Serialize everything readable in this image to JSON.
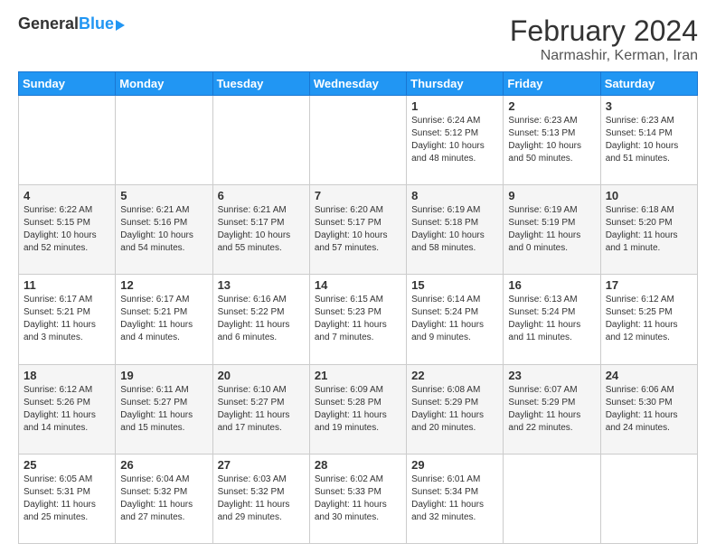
{
  "header": {
    "logo_general": "General",
    "logo_blue": "Blue",
    "title": "February 2024",
    "subtitle": "Narmashir, Kerman, Iran"
  },
  "days_of_week": [
    "Sunday",
    "Monday",
    "Tuesday",
    "Wednesday",
    "Thursday",
    "Friday",
    "Saturday"
  ],
  "weeks": [
    [
      {
        "day": "",
        "info": ""
      },
      {
        "day": "",
        "info": ""
      },
      {
        "day": "",
        "info": ""
      },
      {
        "day": "",
        "info": ""
      },
      {
        "day": "1",
        "info": "Sunrise: 6:24 AM\nSunset: 5:12 PM\nDaylight: 10 hours and 48 minutes."
      },
      {
        "day": "2",
        "info": "Sunrise: 6:23 AM\nSunset: 5:13 PM\nDaylight: 10 hours and 50 minutes."
      },
      {
        "day": "3",
        "info": "Sunrise: 6:23 AM\nSunset: 5:14 PM\nDaylight: 10 hours and 51 minutes."
      }
    ],
    [
      {
        "day": "4",
        "info": "Sunrise: 6:22 AM\nSunset: 5:15 PM\nDaylight: 10 hours and 52 minutes."
      },
      {
        "day": "5",
        "info": "Sunrise: 6:21 AM\nSunset: 5:16 PM\nDaylight: 10 hours and 54 minutes."
      },
      {
        "day": "6",
        "info": "Sunrise: 6:21 AM\nSunset: 5:17 PM\nDaylight: 10 hours and 55 minutes."
      },
      {
        "day": "7",
        "info": "Sunrise: 6:20 AM\nSunset: 5:17 PM\nDaylight: 10 hours and 57 minutes."
      },
      {
        "day": "8",
        "info": "Sunrise: 6:19 AM\nSunset: 5:18 PM\nDaylight: 10 hours and 58 minutes."
      },
      {
        "day": "9",
        "info": "Sunrise: 6:19 AM\nSunset: 5:19 PM\nDaylight: 11 hours and 0 minutes."
      },
      {
        "day": "10",
        "info": "Sunrise: 6:18 AM\nSunset: 5:20 PM\nDaylight: 11 hours and 1 minute."
      }
    ],
    [
      {
        "day": "11",
        "info": "Sunrise: 6:17 AM\nSunset: 5:21 PM\nDaylight: 11 hours and 3 minutes."
      },
      {
        "day": "12",
        "info": "Sunrise: 6:17 AM\nSunset: 5:21 PM\nDaylight: 11 hours and 4 minutes."
      },
      {
        "day": "13",
        "info": "Sunrise: 6:16 AM\nSunset: 5:22 PM\nDaylight: 11 hours and 6 minutes."
      },
      {
        "day": "14",
        "info": "Sunrise: 6:15 AM\nSunset: 5:23 PM\nDaylight: 11 hours and 7 minutes."
      },
      {
        "day": "15",
        "info": "Sunrise: 6:14 AM\nSunset: 5:24 PM\nDaylight: 11 hours and 9 minutes."
      },
      {
        "day": "16",
        "info": "Sunrise: 6:13 AM\nSunset: 5:24 PM\nDaylight: 11 hours and 11 minutes."
      },
      {
        "day": "17",
        "info": "Sunrise: 6:12 AM\nSunset: 5:25 PM\nDaylight: 11 hours and 12 minutes."
      }
    ],
    [
      {
        "day": "18",
        "info": "Sunrise: 6:12 AM\nSunset: 5:26 PM\nDaylight: 11 hours and 14 minutes."
      },
      {
        "day": "19",
        "info": "Sunrise: 6:11 AM\nSunset: 5:27 PM\nDaylight: 11 hours and 15 minutes."
      },
      {
        "day": "20",
        "info": "Sunrise: 6:10 AM\nSunset: 5:27 PM\nDaylight: 11 hours and 17 minutes."
      },
      {
        "day": "21",
        "info": "Sunrise: 6:09 AM\nSunset: 5:28 PM\nDaylight: 11 hours and 19 minutes."
      },
      {
        "day": "22",
        "info": "Sunrise: 6:08 AM\nSunset: 5:29 PM\nDaylight: 11 hours and 20 minutes."
      },
      {
        "day": "23",
        "info": "Sunrise: 6:07 AM\nSunset: 5:29 PM\nDaylight: 11 hours and 22 minutes."
      },
      {
        "day": "24",
        "info": "Sunrise: 6:06 AM\nSunset: 5:30 PM\nDaylight: 11 hours and 24 minutes."
      }
    ],
    [
      {
        "day": "25",
        "info": "Sunrise: 6:05 AM\nSunset: 5:31 PM\nDaylight: 11 hours and 25 minutes."
      },
      {
        "day": "26",
        "info": "Sunrise: 6:04 AM\nSunset: 5:32 PM\nDaylight: 11 hours and 27 minutes."
      },
      {
        "day": "27",
        "info": "Sunrise: 6:03 AM\nSunset: 5:32 PM\nDaylight: 11 hours and 29 minutes."
      },
      {
        "day": "28",
        "info": "Sunrise: 6:02 AM\nSunset: 5:33 PM\nDaylight: 11 hours and 30 minutes."
      },
      {
        "day": "29",
        "info": "Sunrise: 6:01 AM\nSunset: 5:34 PM\nDaylight: 11 hours and 32 minutes."
      },
      {
        "day": "",
        "info": ""
      },
      {
        "day": "",
        "info": ""
      }
    ]
  ]
}
